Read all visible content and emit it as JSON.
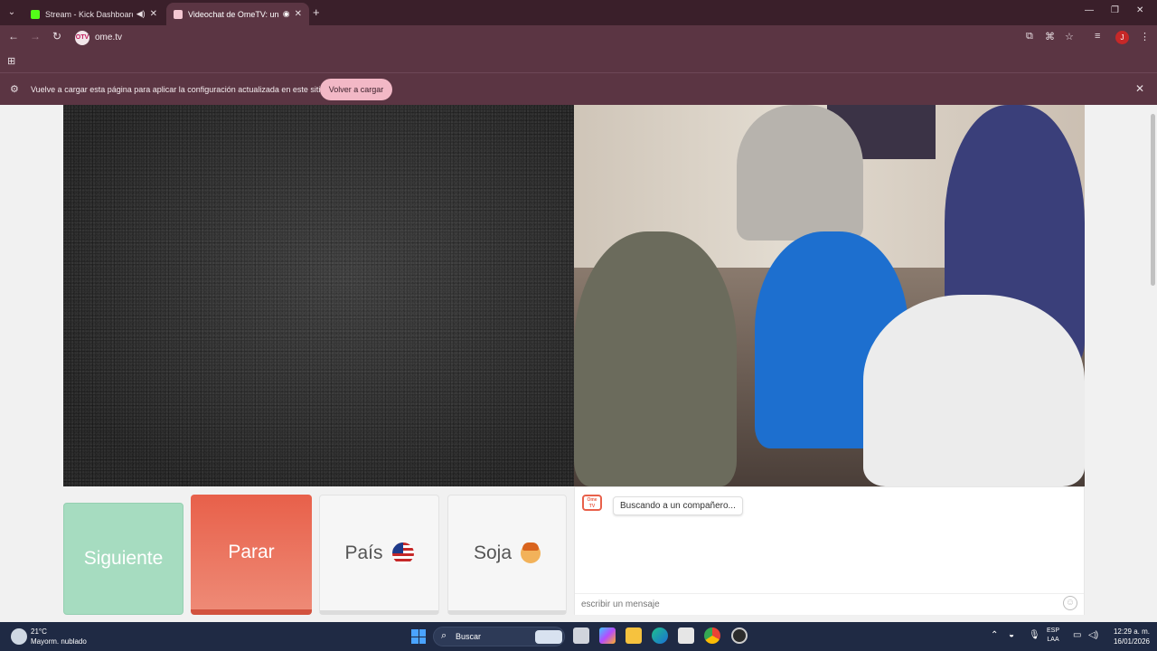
{
  "browser": {
    "tabs": [
      {
        "title": "Stream - Kick Dashboard",
        "favicon_color": "#53fc18"
      },
      {
        "title": "Videochat de OmeTV: una",
        "favicon_color": "#f4c7d2"
      }
    ],
    "url": "ome.tv",
    "site_icon_text": "OTV",
    "profile_initial": "J",
    "infobar": {
      "message": "Vuelve a cargar esta página para aplicar la configuración actualizada en este sitio",
      "reload_label": "Volver a cargar"
    }
  },
  "page": {
    "buttons": {
      "next_label": "Siguiente",
      "stop_label": "Parar",
      "country_label": "País",
      "gender_label": "Soja"
    },
    "chat": {
      "logo_text": "Ome TV",
      "status_message": "Buscando a un compañero...",
      "input_placeholder": "escribir un mensaje"
    }
  },
  "taskbar": {
    "weather_temp": "21°C",
    "weather_desc": "Mayorm. nublado",
    "search_label": "Buscar",
    "lang_line1": "ESP",
    "lang_line2": "LAA",
    "time": "12:29 a. m.",
    "date": "16/01/2026"
  },
  "colors": {
    "stop_button": "#e8604a",
    "next_button": "#a6dcc0",
    "browser_frame": "#5b3543"
  }
}
